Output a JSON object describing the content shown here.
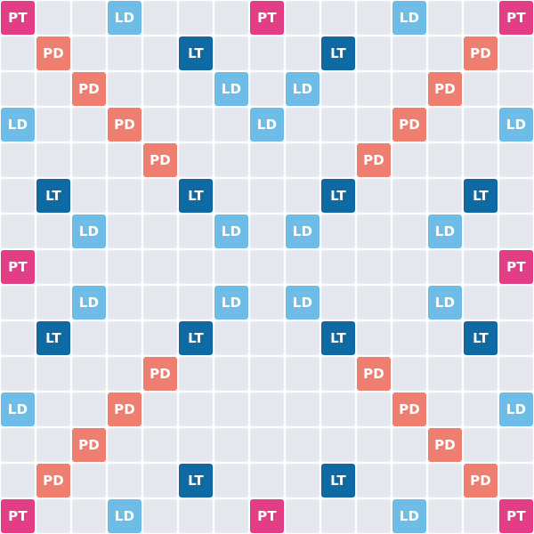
{
  "board": {
    "size": 15,
    "colors": {
      "PT": "#e33d86",
      "LT": "#0f6aa4",
      "LD": "#6ebde8",
      "PD": "#ee7f70",
      "empty": "#e6e8ef"
    },
    "labels": {
      "PT": "PT",
      "LT": "LT",
      "LD": "LD",
      "PD": "PD"
    },
    "rows": [
      [
        "PT",
        "",
        "",
        "LD",
        "",
        "",
        "",
        "PT",
        "",
        "",
        "",
        "LD",
        "",
        "",
        "PT"
      ],
      [
        "",
        "PD",
        "",
        "",
        "",
        "LT",
        "",
        "",
        "",
        "LT",
        "",
        "",
        "",
        "PD",
        ""
      ],
      [
        "",
        "",
        "PD",
        "",
        "",
        "",
        "LD",
        "",
        "LD",
        "",
        "",
        "",
        "PD",
        "",
        ""
      ],
      [
        "LD",
        "",
        "",
        "PD",
        "",
        "",
        "",
        "LD",
        "",
        "",
        "",
        "PD",
        "",
        "",
        "LD"
      ],
      [
        "",
        "",
        "",
        "",
        "PD",
        "",
        "",
        "",
        "",
        "",
        "PD",
        "",
        "",
        "",
        ""
      ],
      [
        "",
        "LT",
        "",
        "",
        "",
        "LT",
        "",
        "",
        "",
        "LT",
        "",
        "",
        "",
        "LT",
        ""
      ],
      [
        "",
        "",
        "LD",
        "",
        "",
        "",
        "LD",
        "",
        "LD",
        "",
        "",
        "",
        "LD",
        "",
        ""
      ],
      [
        "PT",
        "",
        "",
        "",
        "",
        "",
        "",
        "",
        "",
        "",
        "",
        "",
        "",
        "",
        "PT"
      ],
      [
        "",
        "",
        "LD",
        "",
        "",
        "",
        "LD",
        "",
        "LD",
        "",
        "",
        "",
        "LD",
        "",
        ""
      ],
      [
        "",
        "LT",
        "",
        "",
        "",
        "LT",
        "",
        "",
        "",
        "LT",
        "",
        "",
        "",
        "LT",
        ""
      ],
      [
        "",
        "",
        "",
        "",
        "PD",
        "",
        "",
        "",
        "",
        "",
        "PD",
        "",
        "",
        "",
        ""
      ],
      [
        "LD",
        "",
        "",
        "PD",
        "",
        "",
        "",
        "",
        "",
        "",
        "",
        "PD",
        "",
        "",
        "LD"
      ],
      [
        "",
        "",
        "PD",
        "",
        "",
        "",
        "",
        "",
        "",
        "",
        "",
        "",
        "PD",
        "",
        ""
      ],
      [
        "",
        "PD",
        "",
        "",
        "",
        "LT",
        "",
        "",
        "",
        "LT",
        "",
        "",
        "",
        "PD",
        ""
      ],
      [
        "PT",
        "",
        "",
        "LD",
        "",
        "",
        "",
        "PT",
        "",
        "",
        "",
        "LD",
        "",
        "",
        "PT"
      ]
    ]
  }
}
